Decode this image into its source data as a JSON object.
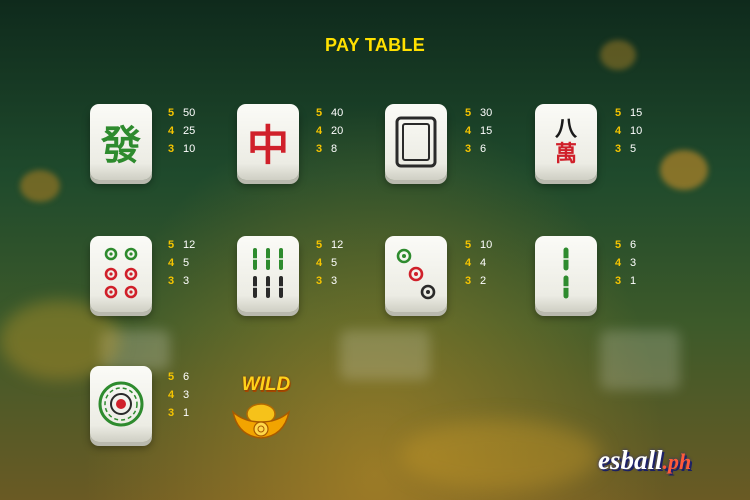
{
  "title": "PAY TABLE",
  "symbols": [
    {
      "icon": "green-fa-tile-icon",
      "glyph": "發",
      "pays": [
        {
          "count": "5",
          "value": "50"
        },
        {
          "count": "4",
          "value": "25"
        },
        {
          "count": "3",
          "value": "10"
        }
      ]
    },
    {
      "icon": "red-zhong-tile-icon",
      "glyph": "中",
      "pays": [
        {
          "count": "5",
          "value": "40"
        },
        {
          "count": "4",
          "value": "20"
        },
        {
          "count": "3",
          "value": "8"
        }
      ]
    },
    {
      "icon": "white-dragon-tile-icon",
      "glyph": "",
      "pays": [
        {
          "count": "5",
          "value": "30"
        },
        {
          "count": "4",
          "value": "15"
        },
        {
          "count": "3",
          "value": "6"
        }
      ]
    },
    {
      "icon": "eight-wan-tile-icon",
      "glyph": "八",
      "glyph2": "萬",
      "pays": [
        {
          "count": "5",
          "value": "15"
        },
        {
          "count": "4",
          "value": "10"
        },
        {
          "count": "3",
          "value": "5"
        }
      ]
    },
    {
      "icon": "six-dots-tile-icon",
      "pays": [
        {
          "count": "5",
          "value": "12"
        },
        {
          "count": "4",
          "value": "5"
        },
        {
          "count": "3",
          "value": "3"
        }
      ]
    },
    {
      "icon": "six-bamboo-tile-icon",
      "pays": [
        {
          "count": "5",
          "value": "12"
        },
        {
          "count": "4",
          "value": "5"
        },
        {
          "count": "3",
          "value": "3"
        }
      ]
    },
    {
      "icon": "three-dots-tile-icon",
      "pays": [
        {
          "count": "5",
          "value": "10"
        },
        {
          "count": "4",
          "value": "4"
        },
        {
          "count": "3",
          "value": "2"
        }
      ]
    },
    {
      "icon": "two-bamboo-tile-icon",
      "pays": [
        {
          "count": "5",
          "value": "6"
        },
        {
          "count": "4",
          "value": "3"
        },
        {
          "count": "3",
          "value": "1"
        }
      ]
    },
    {
      "icon": "one-dot-tile-icon",
      "pays": [
        {
          "count": "5",
          "value": "6"
        },
        {
          "count": "4",
          "value": "3"
        },
        {
          "count": "3",
          "value": "1"
        }
      ]
    }
  ],
  "wild": {
    "label": "WILD",
    "icon": "gold-ingot-icon"
  },
  "logo": {
    "text": "esball",
    "suffix": ".ph"
  },
  "colors": {
    "title": "#ffe000",
    "count": "#f5c400",
    "value": "#ffffff",
    "tile_green": "#2e8b2e",
    "tile_red": "#d0202a",
    "tile_black": "#2a2a2a"
  }
}
